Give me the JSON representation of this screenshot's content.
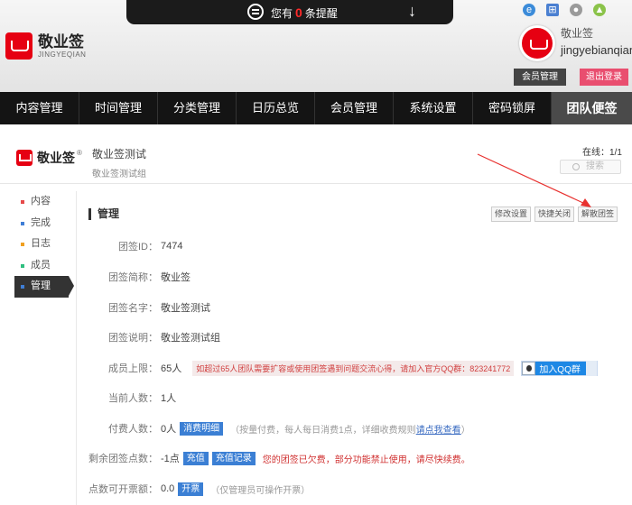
{
  "notice": {
    "prefix": "您有",
    "count": "0",
    "suffix": "条提醒"
  },
  "brand": {
    "name": "敬业签",
    "subtitle": "JINGYEQIAN"
  },
  "user": {
    "name_cn": "敬业签",
    "name_en": "jingyebianqian",
    "member_btn": "会员管理",
    "logout_btn": "退出登录"
  },
  "nav": {
    "items": [
      "内容管理",
      "时间管理",
      "分类管理",
      "日历总览",
      "会员管理",
      "系统设置",
      "密码锁屏",
      "团队便签"
    ],
    "active_index": 7
  },
  "team": {
    "logo_name": "敬业签",
    "logo_mark": "®",
    "title": "敬业签测试",
    "desc": "敬业签测试组",
    "online_label": "在线：",
    "online_value": "1/1",
    "search_placeholder": "搜索"
  },
  "sidebar": {
    "items": [
      {
        "label": "内容",
        "color": "#e64a4a"
      },
      {
        "label": "完成",
        "color": "#3f7ed6"
      },
      {
        "label": "日志",
        "color": "#f0a020"
      },
      {
        "label": "成员",
        "color": "#2fbf7f"
      },
      {
        "label": "管理",
        "color": "#3f7ed6"
      }
    ],
    "active_index": 4
  },
  "main": {
    "title": "管理",
    "buttons": [
      "修改设置",
      "快捷关闭",
      "解散团签"
    ],
    "fields": {
      "id_label": "团签ID：",
      "id_value": "7474",
      "short_label": "团签简称：",
      "short_value": "敬业签",
      "name_label": "团签名字：",
      "name_value": "敬业签测试",
      "desc_label": "团签说明：",
      "desc_value": "敬业签测试组",
      "limit_label": "成员上限：",
      "limit_value": "65人",
      "limit_note": "如超过65人团队需要扩容或使用团签遇到问题交流心得，请加入官方QQ群：823241772",
      "qq_button": "加入QQ群",
      "count_label": "当前人数：",
      "count_value": "1人",
      "paid_label": "付费人数：",
      "paid_value": "0人",
      "paid_btn": "消费明细",
      "paid_note": "（按量付费，每人每日消费1点，详细收费规则",
      "paid_link": "请点我查看",
      "paid_note_end": "）",
      "points_label": "剩余团签点数：",
      "points_value": "-1点",
      "recharge_btn": "充值",
      "recharge_log_btn": "充值记录",
      "points_note": "您的团签已欠费，部分功能禁止使用，请尽快续费。",
      "invoice_label": "点数可开票额：",
      "invoice_value": "0.0",
      "invoice_btn": "开票",
      "invoice_note": "（仅管理员可操作开票）"
    }
  }
}
